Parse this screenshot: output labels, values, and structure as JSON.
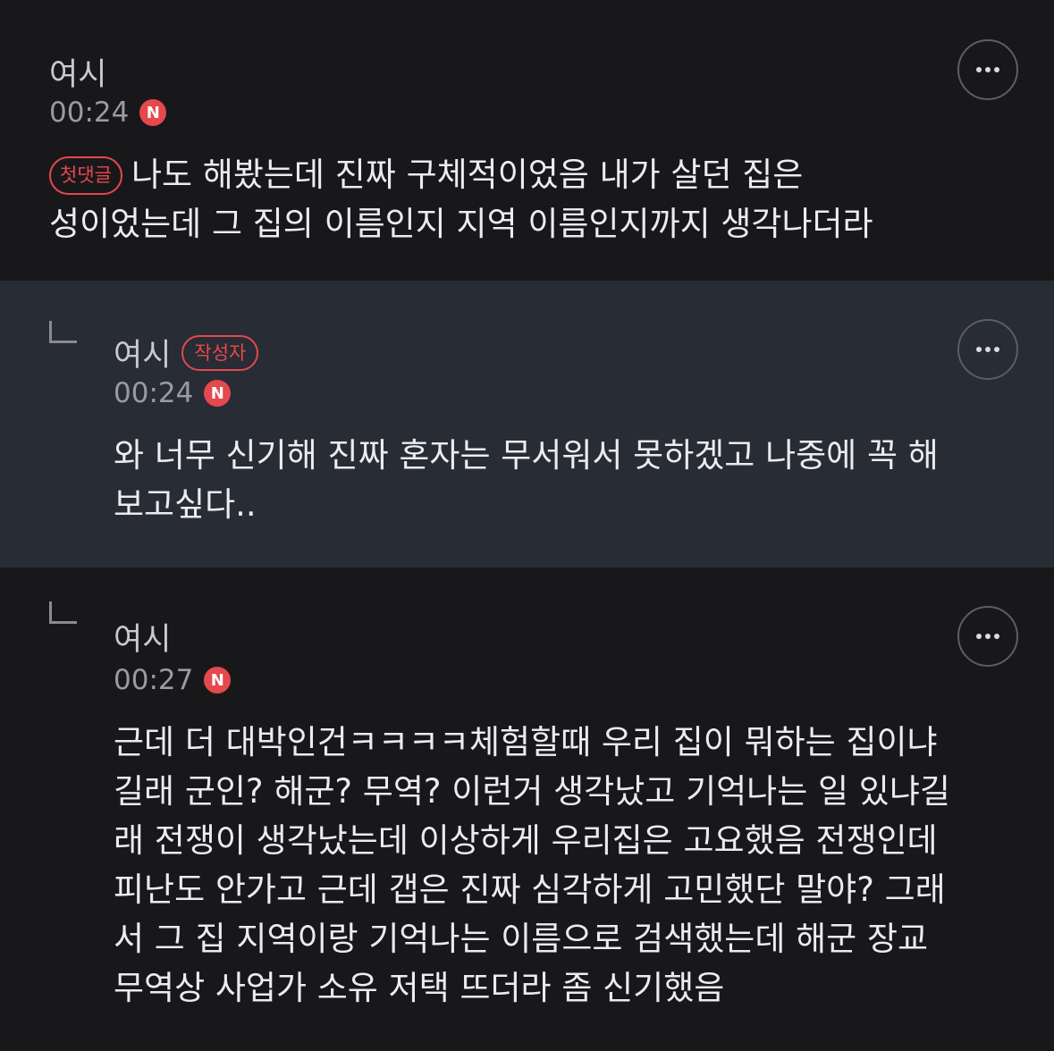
{
  "comments": [
    {
      "author": "여시",
      "time": "00:24",
      "new_badge": "N",
      "tag": "첫댓글",
      "body": "나도 해봤는데 진짜 구체적이었음 내가 살던 집은\n성이었는데 그 집의 이름인지 지역 이름인지까지 생각나더라"
    },
    {
      "author": "여시",
      "author_tag": "작성자",
      "time": "00:24",
      "new_badge": "N",
      "body": "와 너무 신기해 진짜 혼자는 무서워서 못하겠고 나중에 꼭 해\n보고싶다.."
    },
    {
      "author": "여시",
      "time": "00:27",
      "new_badge": "N",
      "body": "근데 더 대박인건ㅋㅋㅋㅋ체험할때 우리 집이 뭐하는 집이냐\n길래 군인? 해군? 무역? 이런거 생각났고 기억나는 일 있냐길\n래 전쟁이 생각났는데 이상하게 우리집은 고요했음 전쟁인데\n피난도 안가고 근데 갭은 진짜 심각하게 고민했단 말야? 그래\n서 그 집 지역이랑 기억나는 이름으로 검색했는데 해군 장교\n무역상 사업가 소유 저택 뜨더라 좀 신기했음"
    }
  ],
  "colors": {
    "background": "#18181b",
    "reply_highlight": "#282c34",
    "accent": "#e5484d"
  },
  "icons": [
    "more-icon",
    "reply-arrow-icon",
    "new-badge"
  ]
}
